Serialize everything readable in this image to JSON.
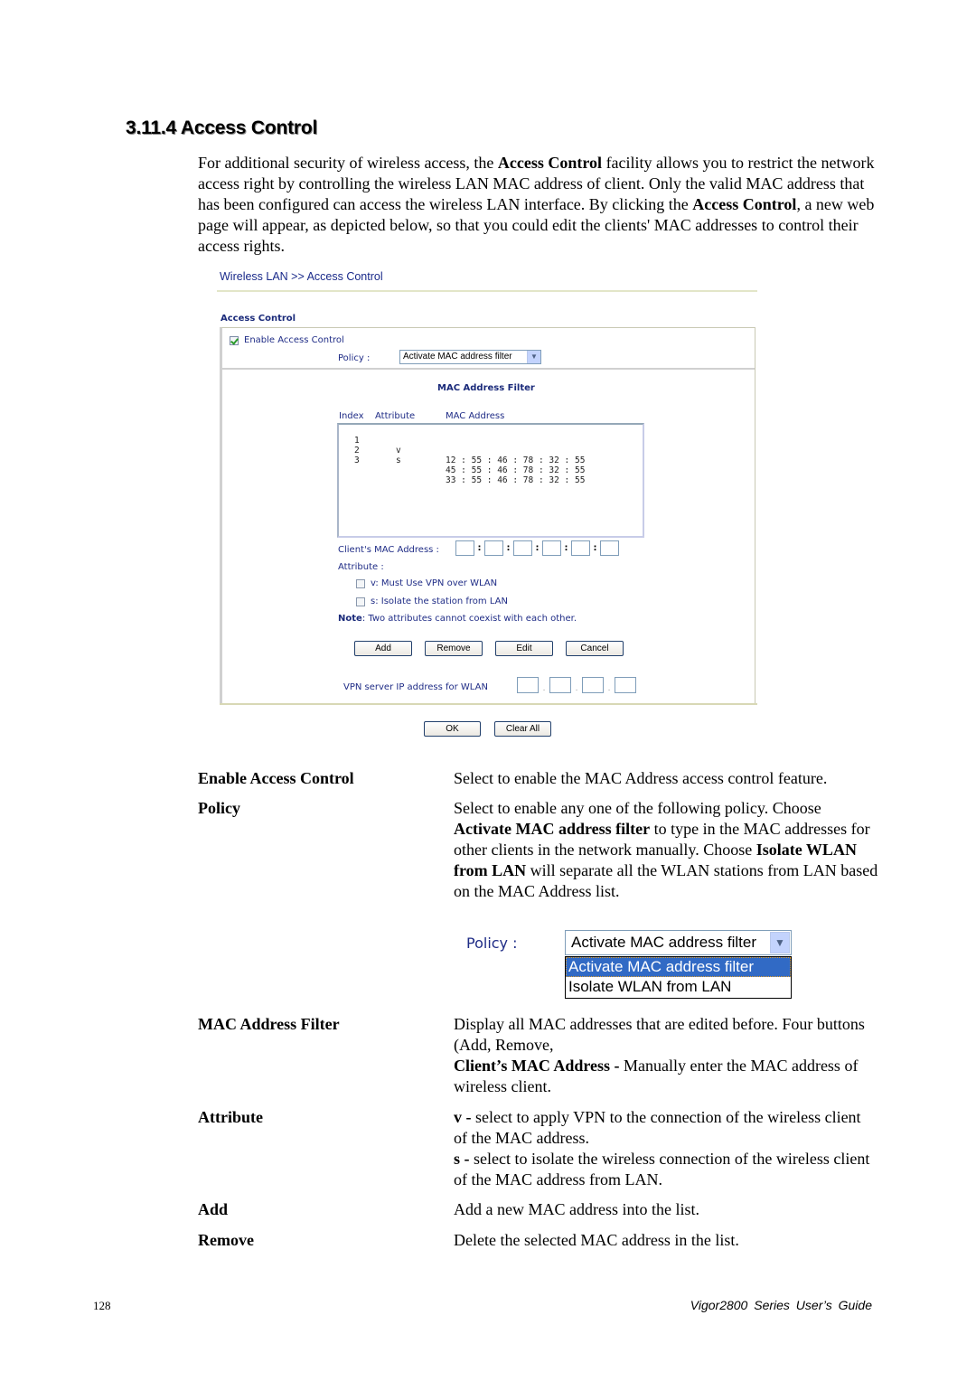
{
  "section": {
    "title": "3.11.4 Access Control"
  },
  "intro": {
    "p1": "For additional security of wireless access, the ",
    "b1": "Access Control",
    "p2": " facility allows you to restrict the network access right by controlling the wireless LAN MAC address of client. Only the valid MAC address that has been configured can access the wireless LAN interface. By clicking the ",
    "b2": "Access Control",
    "p3": ", a new web page will appear, as depicted below, so that you could edit the clients' MAC addresses to control their access rights."
  },
  "ui": {
    "breadcrumb": "Wireless LAN >> Access Control",
    "panel_title": "Access Control",
    "enable_label": "Enable Access Control",
    "enable_checked": true,
    "policy_label": "Policy :",
    "policy_value": "Activate MAC address filter",
    "maf_title": "MAC Address Filter",
    "columns": {
      "index": "Index",
      "attribute": "Attribute",
      "mac": "MAC Address"
    },
    "rows": [
      {
        "index": "1",
        "attribute": "v",
        "mac": "12 : 55 : 46 : 78 : 32 : 55"
      },
      {
        "index": "2",
        "attribute": "s",
        "mac": "45 : 55 : 46 : 78 : 32 : 55"
      },
      {
        "index": "3",
        "attribute": "",
        "mac": "33 : 55 : 46 : 78 : 32 : 55"
      }
    ],
    "client_mac_label": "Client's MAC Address :",
    "mac_separator": ":",
    "client_mac_values": [
      "",
      "",
      "",
      "",
      "",
      ""
    ],
    "attribute_label": "Attribute :",
    "attr_v_label": "v: Must Use VPN over WLAN",
    "attr_s_label": "s: Isolate the station from LAN",
    "attr_v_checked": false,
    "attr_s_checked": false,
    "note_label": "Note",
    "note_text": ": Two attributes cannot coexist with each other.",
    "buttons": {
      "add": "Add",
      "remove": "Remove",
      "edit": "Edit",
      "cancel": "Cancel",
      "ok": "OK",
      "clear_all": "Clear All"
    },
    "vpn_label": "VPN server IP address for WLAN",
    "ip_separator": ".",
    "vpn_ip_values": [
      "",
      "",
      "",
      ""
    ]
  },
  "descriptions": [
    {
      "term": "Enable Access Control",
      "body": "Select to enable the MAC Address access control feature."
    },
    {
      "term": "Policy",
      "body_parts": [
        "Select to enable any one of the following policy. Choose ",
        "Activate MAC address filter",
        " to type in the MAC addresses for other clients in the network manually. Choose ",
        "Isolate WLAN from LAN",
        " will separate all the WLAN stations from LAN based on the MAC Address list."
      ]
    },
    {
      "term": "MAC Address Filter",
      "body_parts": [
        "Display all MAC addresses that are edited before. Four buttons (Add, Remove,",
        "Client’s MAC Address -",
        " Manually enter the MAC address of wireless client."
      ]
    },
    {
      "term": "Attribute",
      "body_parts": [
        "v -",
        " select to apply VPN to the connection of the wireless client of the MAC address.",
        "s -",
        " select to isolate the wireless connection of the wireless client of the MAC address from LAN."
      ]
    },
    {
      "term": "Add",
      "body": "Add a new MAC address into the list."
    },
    {
      "term": "Remove",
      "body": "Delete the selected MAC address in the list."
    }
  ],
  "policy_dropdown": {
    "label": "Policy :",
    "value": "Activate MAC address filter",
    "options": [
      "Activate MAC address filter",
      "Isolate WLAN from LAN"
    ],
    "selected_index": 0
  },
  "footer": {
    "page_number": "128",
    "guide_title": "Vigor2800 Series User’s Guide"
  }
}
